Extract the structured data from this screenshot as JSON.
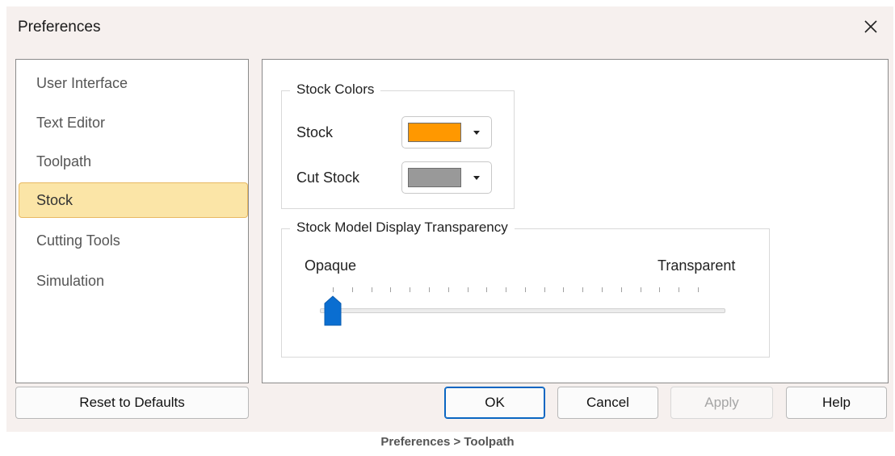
{
  "window": {
    "title": "Preferences"
  },
  "nav": {
    "items": [
      {
        "label": "User Interface"
      },
      {
        "label": "Text Editor"
      },
      {
        "label": "Toolpath"
      },
      {
        "label": "Stock",
        "selected": true
      },
      {
        "label": "Cutting Tools"
      },
      {
        "label": "Simulation"
      }
    ]
  },
  "stock_colors": {
    "title": "Stock Colors",
    "stock_label": "Stock",
    "stock_color": "#ff9800",
    "cut_stock_label": "Cut Stock",
    "cut_stock_color": "#999999"
  },
  "transparency": {
    "title": "Stock Model Display Transparency",
    "min_label": "Opaque",
    "max_label": "Transparent",
    "value_percent": 0
  },
  "buttons": {
    "reset": "Reset to Defaults",
    "ok": "OK",
    "cancel": "Cancel",
    "apply": "Apply",
    "help": "Help"
  },
  "caption": "Preferences > Toolpath",
  "colors": {
    "accent": "#0a6ed1",
    "selection_bg": "#fbe5a7",
    "selection_border": "#e8b962"
  }
}
